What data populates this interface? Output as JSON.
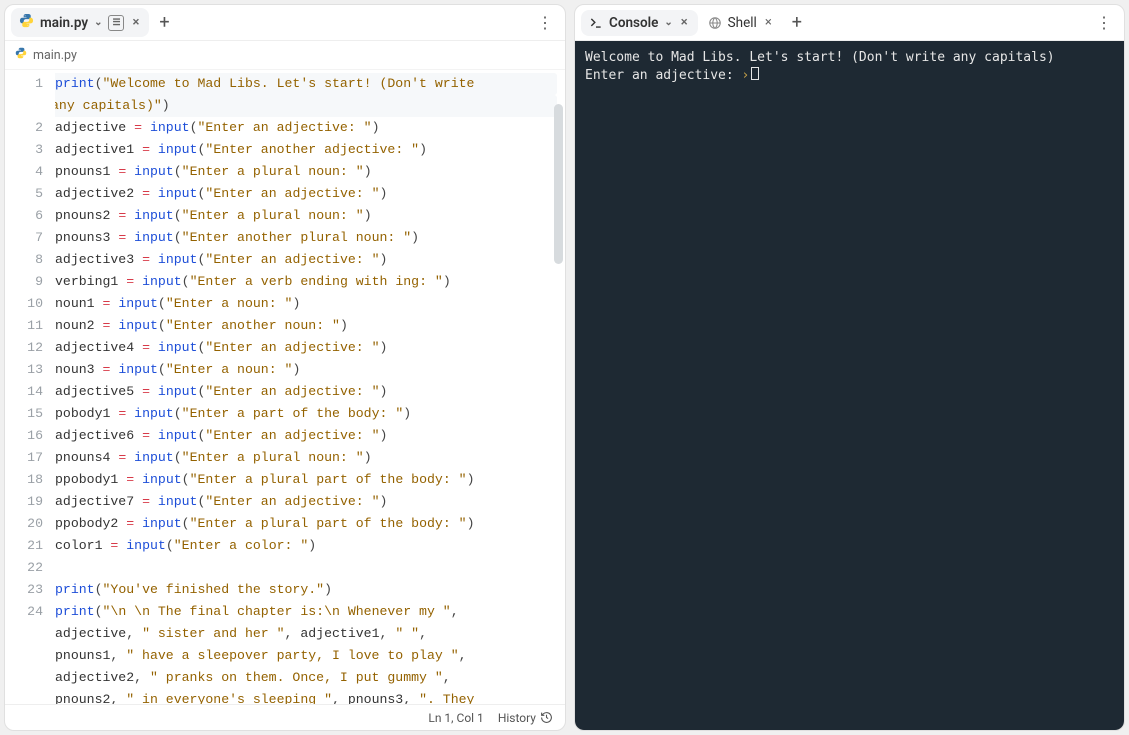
{
  "left": {
    "tab": {
      "label": "main.py",
      "closeable": true
    },
    "breadcrumb": "main.py",
    "statusbar": {
      "pos": "Ln 1, Col 1",
      "history": "History"
    },
    "gutter_lines": [
      "1",
      "2",
      "3",
      "4",
      "5",
      "6",
      "7",
      "8",
      "9",
      "10",
      "11",
      "12",
      "13",
      "14",
      "15",
      "16",
      "17",
      "18",
      "19",
      "20",
      "21",
      "22",
      "23",
      "24",
      "",
      "",
      "",
      ""
    ],
    "code": [
      {
        "n": "1",
        "hl": true,
        "seg": [
          [
            "fn",
            "print"
          ],
          [
            "p",
            "("
          ],
          [
            "s",
            "\"Welcome to Mad Libs. Let's start! (Don't write "
          ]
        ]
      },
      {
        "n": "",
        "cont": true,
        "hl": true,
        "seg": [
          [
            "s",
            "any capitals)\""
          ],
          [
            "p",
            ")"
          ]
        ]
      },
      {
        "n": "2",
        "seg": [
          [
            "v",
            "adjective "
          ],
          [
            "op",
            "="
          ],
          [
            "v",
            " "
          ],
          [
            "fn",
            "input"
          ],
          [
            "p",
            "("
          ],
          [
            "s",
            "\"Enter an adjective: \""
          ],
          [
            "p",
            ")"
          ]
        ]
      },
      {
        "n": "3",
        "seg": [
          [
            "v",
            "adjective1 "
          ],
          [
            "op",
            "="
          ],
          [
            "v",
            " "
          ],
          [
            "fn",
            "input"
          ],
          [
            "p",
            "("
          ],
          [
            "s",
            "\"Enter another adjective: \""
          ],
          [
            "p",
            ")"
          ]
        ]
      },
      {
        "n": "4",
        "seg": [
          [
            "v",
            "pnouns1 "
          ],
          [
            "op",
            "="
          ],
          [
            "v",
            " "
          ],
          [
            "fn",
            "input"
          ],
          [
            "p",
            "("
          ],
          [
            "s",
            "\"Enter a plural noun: \""
          ],
          [
            "p",
            ")"
          ]
        ]
      },
      {
        "n": "5",
        "seg": [
          [
            "v",
            "adjective2 "
          ],
          [
            "op",
            "="
          ],
          [
            "v",
            " "
          ],
          [
            "fn",
            "input"
          ],
          [
            "p",
            "("
          ],
          [
            "s",
            "\"Enter an adjective: \""
          ],
          [
            "p",
            ")"
          ]
        ]
      },
      {
        "n": "6",
        "seg": [
          [
            "v",
            "pnouns2 "
          ],
          [
            "op",
            "="
          ],
          [
            "v",
            " "
          ],
          [
            "fn",
            "input"
          ],
          [
            "p",
            "("
          ],
          [
            "s",
            "\"Enter a plural noun: \""
          ],
          [
            "p",
            ")"
          ]
        ]
      },
      {
        "n": "7",
        "seg": [
          [
            "v",
            "pnouns3 "
          ],
          [
            "op",
            "="
          ],
          [
            "v",
            " "
          ],
          [
            "fn",
            "input"
          ],
          [
            "p",
            "("
          ],
          [
            "s",
            "\"Enter another plural noun: \""
          ],
          [
            "p",
            ")"
          ]
        ]
      },
      {
        "n": "8",
        "seg": [
          [
            "v",
            "adjective3 "
          ],
          [
            "op",
            "="
          ],
          [
            "v",
            " "
          ],
          [
            "fn",
            "input"
          ],
          [
            "p",
            "("
          ],
          [
            "s",
            "\"Enter an adjective: \""
          ],
          [
            "p",
            ")"
          ]
        ]
      },
      {
        "n": "9",
        "seg": [
          [
            "v",
            "verbing1 "
          ],
          [
            "op",
            "="
          ],
          [
            "v",
            " "
          ],
          [
            "fn",
            "input"
          ],
          [
            "p",
            "("
          ],
          [
            "s",
            "\"Enter a verb ending with ing: \""
          ],
          [
            "p",
            ")"
          ]
        ]
      },
      {
        "n": "10",
        "seg": [
          [
            "v",
            "noun1 "
          ],
          [
            "op",
            "="
          ],
          [
            "v",
            " "
          ],
          [
            "fn",
            "input"
          ],
          [
            "p",
            "("
          ],
          [
            "s",
            "\"Enter a noun: \""
          ],
          [
            "p",
            ")"
          ]
        ]
      },
      {
        "n": "11",
        "seg": [
          [
            "v",
            "noun2 "
          ],
          [
            "op",
            "="
          ],
          [
            "v",
            " "
          ],
          [
            "fn",
            "input"
          ],
          [
            "p",
            "("
          ],
          [
            "s",
            "\"Enter another noun: \""
          ],
          [
            "p",
            ")"
          ]
        ]
      },
      {
        "n": "12",
        "seg": [
          [
            "v",
            "adjective4 "
          ],
          [
            "op",
            "="
          ],
          [
            "v",
            " "
          ],
          [
            "fn",
            "input"
          ],
          [
            "p",
            "("
          ],
          [
            "s",
            "\"Enter an adjective: \""
          ],
          [
            "p",
            ")"
          ]
        ]
      },
      {
        "n": "13",
        "seg": [
          [
            "v",
            "noun3 "
          ],
          [
            "op",
            "="
          ],
          [
            "v",
            " "
          ],
          [
            "fn",
            "input"
          ],
          [
            "p",
            "("
          ],
          [
            "s",
            "\"Enter a noun: \""
          ],
          [
            "p",
            ")"
          ]
        ]
      },
      {
        "n": "14",
        "seg": [
          [
            "v",
            "adjective5 "
          ],
          [
            "op",
            "="
          ],
          [
            "v",
            " "
          ],
          [
            "fn",
            "input"
          ],
          [
            "p",
            "("
          ],
          [
            "s",
            "\"Enter an adjective: \""
          ],
          [
            "p",
            ")"
          ]
        ]
      },
      {
        "n": "15",
        "seg": [
          [
            "v",
            "pobody1 "
          ],
          [
            "op",
            "="
          ],
          [
            "v",
            " "
          ],
          [
            "fn",
            "input"
          ],
          [
            "p",
            "("
          ],
          [
            "s",
            "\"Enter a part of the body: \""
          ],
          [
            "p",
            ")"
          ]
        ]
      },
      {
        "n": "16",
        "seg": [
          [
            "v",
            "adjective6 "
          ],
          [
            "op",
            "="
          ],
          [
            "v",
            " "
          ],
          [
            "fn",
            "input"
          ],
          [
            "p",
            "("
          ],
          [
            "s",
            "\"Enter an adjective: \""
          ],
          [
            "p",
            ")"
          ]
        ]
      },
      {
        "n": "17",
        "seg": [
          [
            "v",
            "pnouns4 "
          ],
          [
            "op",
            "="
          ],
          [
            "v",
            " "
          ],
          [
            "fn",
            "input"
          ],
          [
            "p",
            "("
          ],
          [
            "s",
            "\"Enter a plural noun: \""
          ],
          [
            "p",
            ")"
          ]
        ]
      },
      {
        "n": "18",
        "seg": [
          [
            "v",
            "ppobody1 "
          ],
          [
            "op",
            "="
          ],
          [
            "v",
            " "
          ],
          [
            "fn",
            "input"
          ],
          [
            "p",
            "("
          ],
          [
            "s",
            "\"Enter a plural part of the body: \""
          ],
          [
            "p",
            ")"
          ]
        ]
      },
      {
        "n": "19",
        "seg": [
          [
            "v",
            "adjective7 "
          ],
          [
            "op",
            "="
          ],
          [
            "v",
            " "
          ],
          [
            "fn",
            "input"
          ],
          [
            "p",
            "("
          ],
          [
            "s",
            "\"Enter an adjective: \""
          ],
          [
            "p",
            ")"
          ]
        ]
      },
      {
        "n": "20",
        "seg": [
          [
            "v",
            "ppobody2 "
          ],
          [
            "op",
            "="
          ],
          [
            "v",
            " "
          ],
          [
            "fn",
            "input"
          ],
          [
            "p",
            "("
          ],
          [
            "s",
            "\"Enter a plural part of the body: \""
          ],
          [
            "p",
            ")"
          ]
        ]
      },
      {
        "n": "21",
        "seg": [
          [
            "v",
            "color1 "
          ],
          [
            "op",
            "="
          ],
          [
            "v",
            " "
          ],
          [
            "fn",
            "input"
          ],
          [
            "p",
            "("
          ],
          [
            "s",
            "\"Enter a color: \""
          ],
          [
            "p",
            ")"
          ]
        ]
      },
      {
        "n": "22",
        "seg": [
          [
            "v",
            ""
          ]
        ]
      },
      {
        "n": "23",
        "seg": [
          [
            "fn",
            "print"
          ],
          [
            "p",
            "("
          ],
          [
            "s",
            "\"You've finished the story.\""
          ],
          [
            "p",
            ")"
          ]
        ]
      },
      {
        "n": "24",
        "seg": [
          [
            "fn",
            "print"
          ],
          [
            "p",
            "("
          ],
          [
            "s",
            "\"\\n \\n The final chapter is:\\n Whenever my \""
          ],
          [
            "p",
            ", "
          ]
        ]
      },
      {
        "n": "",
        "cont": true,
        "seg": [
          [
            "v",
            "adjective"
          ],
          [
            "p",
            ", "
          ],
          [
            "s",
            "\" sister and her \""
          ],
          [
            "p",
            ", "
          ],
          [
            "v",
            "adjective1"
          ],
          [
            "p",
            ", "
          ],
          [
            "s",
            "\" \""
          ],
          [
            "p",
            ", "
          ]
        ]
      },
      {
        "n": "",
        "cont": true,
        "seg": [
          [
            "v",
            "pnouns1"
          ],
          [
            "p",
            ", "
          ],
          [
            "s",
            "\" have a sleepover party, I love to play \""
          ],
          [
            "p",
            ", "
          ]
        ]
      },
      {
        "n": "",
        "cont": true,
        "seg": [
          [
            "v",
            "adjective2"
          ],
          [
            "p",
            ", "
          ],
          [
            "s",
            "\" pranks on them. Once, I put gummy \""
          ],
          [
            "p",
            ", "
          ]
        ]
      },
      {
        "n": "",
        "cont": true,
        "seg": [
          [
            "v",
            "pnouns2"
          ],
          [
            "p",
            ", "
          ],
          [
            "s",
            "\" in everyone's sleeping \""
          ],
          [
            "p",
            ", "
          ],
          [
            "v",
            "pnouns3"
          ],
          [
            "p",
            ", "
          ],
          [
            "s",
            "\". They"
          ]
        ]
      }
    ]
  },
  "right": {
    "tabs": [
      {
        "label": "Console",
        "active": true,
        "closeable": true
      },
      {
        "label": "Shell",
        "active": false,
        "closeable": true
      }
    ],
    "console": {
      "line1": "Welcome to Mad Libs. Let's start! (Don't write any capitals)",
      "line2_prefix": "Enter an adjective: ",
      "caret": "›"
    }
  }
}
